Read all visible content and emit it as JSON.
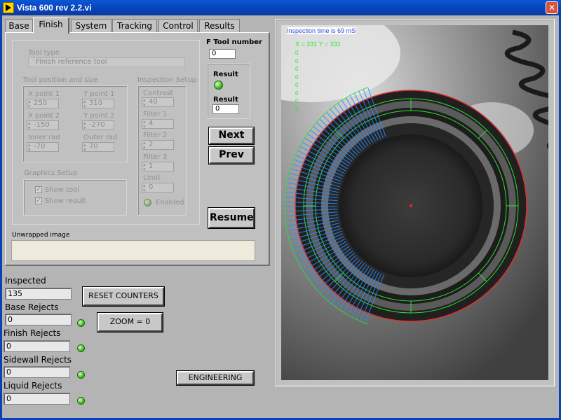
{
  "window": {
    "title": "Vista 600 rev 2.2.vi",
    "close_glyph": "✕"
  },
  "tabs": [
    {
      "label": "Base"
    },
    {
      "label": "Finish"
    },
    {
      "label": "System"
    },
    {
      "label": "Tracking"
    },
    {
      "label": "Control"
    },
    {
      "label": "Results"
    }
  ],
  "finish": {
    "tool_type_label": "Tool type",
    "tool_type_value": "Finish reference tool",
    "f_tool_number_label": "F Tool number",
    "f_tool_number_value": "0",
    "tool_pos_label": "Tool position and size",
    "x1_label": "X point 1",
    "x1_value": "250",
    "y1_label": "Y point 1",
    "y1_value": "310",
    "x2_label": "X point 2",
    "x2_value": "-150",
    "y2_label": "Y point 2",
    "y2_value": "-270",
    "inner_label": "Inner rad",
    "inner_value": "-70",
    "outer_label": "Outer rad",
    "outer_value": "70",
    "insp_setup_label": "Inspection Setup",
    "contrast_label": "Contrast",
    "contrast_value": "40",
    "filter1_label": "Filter 1",
    "filter1_value": "4",
    "filter2_label": "Filter 2",
    "filter2_value": "2",
    "filter3_label": "Filter 3",
    "filter3_value": "1",
    "limit_label": "Limit",
    "limit_value": "0",
    "enabled_label": "Enabled",
    "graphics_label": "Graphics Setup",
    "show_tool_label": "Show tool",
    "show_result_label": "Show result",
    "result_led_label": "Result",
    "result_label": "Result",
    "result_value": "0",
    "unwrapped_label": "Unwrapped image",
    "next_label": "Next",
    "prev_label": "Prev",
    "resume_label": "Resume",
    "check_glyph": "✓"
  },
  "counters": {
    "inspected_label": "Inspected",
    "inspected_value": "135",
    "base_label": "Base Rejects",
    "base_value": "0",
    "finish_label": "Finish Rejects",
    "finish_value": "0",
    "sidewall_label": "Sidewall Rejects",
    "sidewall_value": "0",
    "liquid_label": "Liquid Rejects",
    "liquid_value": "0"
  },
  "buttons": {
    "reset_label": "RESET COUNTERS",
    "zoom_label": "ZOOM = 0",
    "engineering_label": "ENGINEERING"
  },
  "image": {
    "inspection_time": "Inspection time is 69 mS",
    "coord_text": "X = 231  Y = 331",
    "zero_column": [
      "0",
      "0",
      "0",
      "0",
      "0",
      "0",
      "0",
      "0"
    ]
  }
}
